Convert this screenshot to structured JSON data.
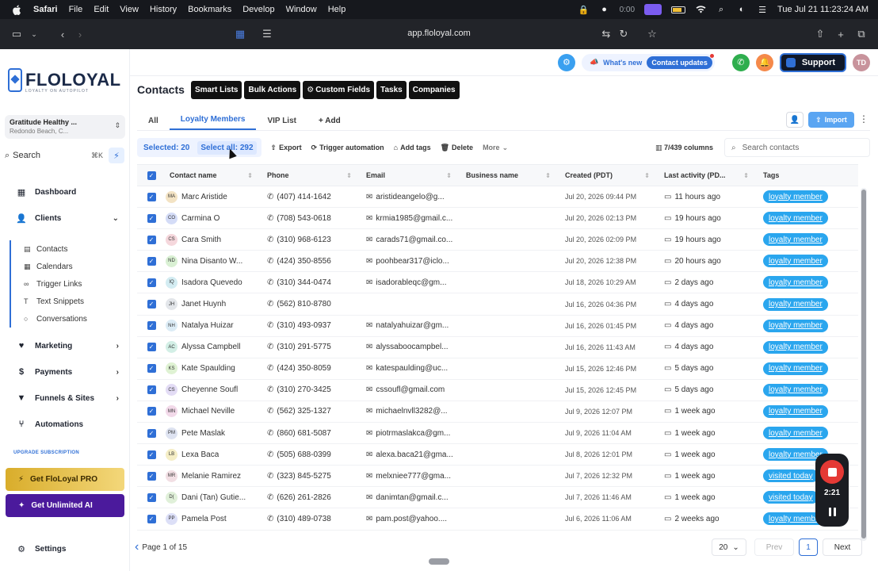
{
  "menubar": {
    "app": "Safari",
    "items": [
      "File",
      "Edit",
      "View",
      "History",
      "Bookmarks",
      "Develop",
      "Window",
      "Help"
    ],
    "recording_time": "0:00",
    "datetime": "Tue Jul 21  11:23:24 AM"
  },
  "browser": {
    "url": "app.floloyal.com"
  },
  "sidebar": {
    "brand": "FLOLOYAL",
    "tagline": "LOYALTY ON AUTOPILOT",
    "account": {
      "name": "Gratitude Healthy ...",
      "location": "Redondo Beach, C..."
    },
    "search": {
      "label": "Search",
      "shortcut": "⌘K"
    },
    "nav": {
      "dashboard": "Dashboard",
      "clients": "Clients",
      "marketing": "Marketing",
      "payments": "Payments",
      "funnels": "Funnels & Sites",
      "automations": "Automations",
      "settings": "Settings"
    },
    "subnav": [
      "Contacts",
      "Calendars",
      "Trigger Links",
      "Text Snippets",
      "Conversations"
    ],
    "upgrade_label": "UPGRADE SUBSCRIPTION",
    "promo_pro": "Get FloLoyal PRO",
    "promo_ai": "Get Unlimited AI"
  },
  "topbar": {
    "whats_new": "What's new",
    "contact_updates": "Contact updates",
    "support": "Support",
    "avatar": "TD"
  },
  "page": {
    "title": "Contacts",
    "buttons": [
      "Smart Lists",
      "Bulk Actions",
      "Custom Fields",
      "Tasks",
      "Companies"
    ],
    "tabs": [
      "All",
      "Loyalty Members",
      "VIP List"
    ],
    "add_tab": "Add",
    "import": "Import"
  },
  "actions": {
    "selected": "Selected: 20",
    "select_all": "Select all: 292",
    "export": "Export",
    "trigger": "Trigger automation",
    "add_tags": "Add tags",
    "delete": "Delete",
    "more": "More",
    "columns": "7/439 columns",
    "search_placeholder": "Search contacts"
  },
  "table": {
    "columns": [
      "Contact name",
      "Phone",
      "Email",
      "Business name",
      "Created (PDT)",
      "Last activity (PD...",
      "Tags"
    ],
    "rows": [
      {
        "initials": "MA",
        "name": "Marc Aristide",
        "phone": "(407) 414-1642",
        "email": "aristideangelo@g...",
        "created": "Jul 20, 2026 09:44 PM",
        "activity": "11 hours ago",
        "tag": "loyalty member",
        "color": "#f3e3c4"
      },
      {
        "initials": "CO",
        "name": "Carmina O",
        "phone": "(708) 543-0618",
        "email": "krmia1985@gmail.c...",
        "created": "Jul 20, 2026 02:13 PM",
        "activity": "19 hours ago",
        "tag": "loyalty member",
        "color": "#d4dcf7"
      },
      {
        "initials": "CS",
        "name": "Cara Smith",
        "phone": "(310) 968-6123",
        "email": "carads71@gmail.co...",
        "created": "Jul 20, 2026 02:09 PM",
        "activity": "19 hours ago",
        "tag": "loyalty member",
        "color": "#f5d7dc"
      },
      {
        "initials": "ND",
        "name": "Nina Disanto W...",
        "phone": "(424) 350-8556",
        "email": "poohbear317@iclo...",
        "created": "Jul 20, 2026 12:38 PM",
        "activity": "20 hours ago",
        "tag": "loyalty member",
        "color": "#d9f0d3"
      },
      {
        "initials": "IQ",
        "name": "Isadora Quevedo",
        "phone": "(310) 344-0474",
        "email": "isadorableqc@gm...",
        "created": "Jul 18, 2026 10:29 AM",
        "activity": "2 days ago",
        "tag": "loyalty member",
        "color": "#d3ecf2"
      },
      {
        "initials": "JH",
        "name": "Janet Huynh",
        "phone": "(562) 810-8780",
        "email": "",
        "created": "Jul 16, 2026 04:36 PM",
        "activity": "4 days ago",
        "tag": "loyalty member",
        "color": "#e3e6ea"
      },
      {
        "initials": "NH",
        "name": "Natalya Huizar",
        "phone": "(310) 493-0937",
        "email": "natalyahuizar@gm...",
        "created": "Jul 16, 2026 01:45 PM",
        "activity": "4 days ago",
        "tag": "loyalty member",
        "color": "#dcecf6"
      },
      {
        "initials": "AC",
        "name": "Alyssa Campbell",
        "phone": "(310) 291-5775",
        "email": "alyssaboocampbel...",
        "created": "Jul 16, 2026 11:43 AM",
        "activity": "4 days ago",
        "tag": "loyalty member",
        "color": "#d3efe6"
      },
      {
        "initials": "KS",
        "name": "Kate Spaulding",
        "phone": "(424) 350-8059",
        "email": "katespaulding@uc...",
        "created": "Jul 15, 2026 12:46 PM",
        "activity": "5 days ago",
        "tag": "loyalty member",
        "color": "#dff2d3"
      },
      {
        "initials": "CS",
        "name": "Cheyenne Soufl",
        "phone": "(310) 270-3425",
        "email": "cssoufl@gmail.com",
        "created": "Jul 15, 2026 12:45 PM",
        "activity": "5 days ago",
        "tag": "loyalty member",
        "color": "#e3dcf5"
      },
      {
        "initials": "MN",
        "name": "Michael Neville",
        "phone": "(562) 325-1327",
        "email": "michaelnvll3282@...",
        "created": "Jul 9, 2026 12:07 PM",
        "activity": "1 week ago",
        "tag": "loyalty member",
        "color": "#f2d9e9"
      },
      {
        "initials": "PM",
        "name": "Pete Maslak",
        "phone": "(860) 681-5087",
        "email": "piotrmaslakca@gm...",
        "created": "Jul 9, 2026 11:04 AM",
        "activity": "1 week ago",
        "tag": "loyalty member",
        "color": "#dee3f1"
      },
      {
        "initials": "LB",
        "name": "Lexa Baca",
        "phone": "(505) 688-0399",
        "email": "alexa.baca21@gma...",
        "created": "Jul 8, 2026 12:01 PM",
        "activity": "1 week ago",
        "tag": "loyalty member",
        "color": "#f5eec6"
      },
      {
        "initials": "MR",
        "name": "Melanie Ramirez",
        "phone": "(323) 845-5275",
        "email": "melxniee777@gma...",
        "created": "Jul 7, 2026 12:32 PM",
        "activity": "1 week ago",
        "tag": "visited today",
        "color": "#f2dfe4"
      },
      {
        "initials": "D(",
        "name": "Dani (Tan) Gutie...",
        "phone": "(626) 261-2826",
        "email": "danimtan@gmail.c...",
        "created": "Jul 7, 2026 11:46 AM",
        "activity": "1 week ago",
        "tag": "visited today",
        "color": "#e0f0d9"
      },
      {
        "initials": "PP",
        "name": "Pamela Post",
        "phone": "(310) 489-0738",
        "email": "pam.post@yahoo....",
        "created": "Jul 6, 2026 11:06 AM",
        "activity": "2 weeks ago",
        "tag": "loyalty member",
        "color": "#dcdff7"
      }
    ]
  },
  "footer": {
    "page": "Page 1 of 15",
    "per_page": "20",
    "prev": "Prev",
    "current": "1",
    "next": "Next"
  },
  "recorder": {
    "time": "2:21"
  }
}
